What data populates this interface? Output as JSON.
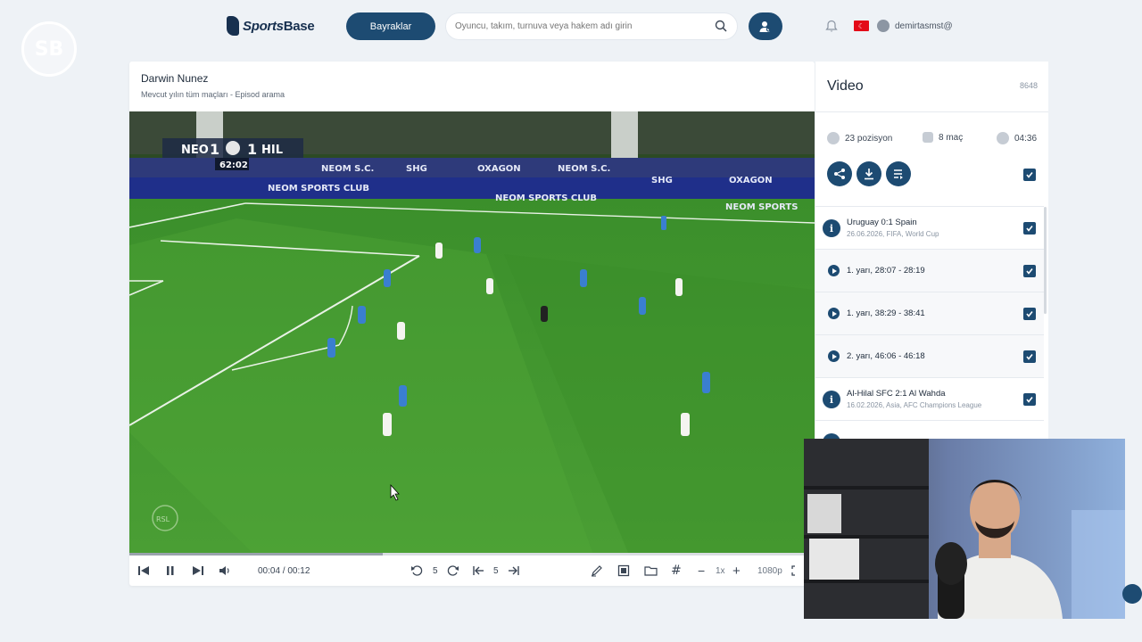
{
  "watermark": {
    "text": "SB"
  },
  "header": {
    "logo_text_italic": "Sports",
    "logo_text_bold": "Base",
    "flags_button": "Bayraklar",
    "search_placeholder": "Oyuncu, takım, turnuva veya hakem adı girin",
    "username": "demirtasmst@"
  },
  "main": {
    "title": "Darwin Nunez",
    "subtitle": "Mevcut yılın tüm maçları - Episod arama",
    "scoreboard": {
      "home": "NEO",
      "home_score": "1",
      "away_score": "1",
      "away": "HIL",
      "clock": "62:02"
    },
    "ad_boards": [
      "NEOM S.C.",
      "SHG",
      "OXAGON",
      "NEOM S.C.",
      "SHG",
      "OXAGON"
    ],
    "ad_strip": [
      "NEOM SPORTS CLUB",
      "NEOM SPORTS CLUB",
      "NEOM SPORTS"
    ],
    "pitch_logo": "RSL",
    "progress_fraction": 0.37
  },
  "controls": {
    "time": "00:04 / 00:12",
    "rewind_seconds": "5",
    "frame_step": "5",
    "speed": "1x",
    "quality": "1080p"
  },
  "panel": {
    "title": "Video",
    "count": "8648",
    "positions": "23 pozisyon",
    "matches": "8 maç",
    "duration": "04:36",
    "items": [
      {
        "kind": "match",
        "title": "Uruguay 0:1 Spain",
        "sub": "26.06.2026, FIFA, World Cup"
      },
      {
        "kind": "clip",
        "title": "1. yarı, 28:07 - 28:19"
      },
      {
        "kind": "clip",
        "title": "1. yarı, 38:29 - 38:41"
      },
      {
        "kind": "clip",
        "title": "2. yarı, 46:06 - 46:18"
      },
      {
        "kind": "match",
        "title": "Al-Hilal SFC 2:1 Al Wahda",
        "sub": "16.02.2026, Asia, AFC Champions League"
      }
    ]
  },
  "colors": {
    "primary": "#1d4b72",
    "background": "#eef2f6",
    "pitch": "#3d8a2c"
  }
}
